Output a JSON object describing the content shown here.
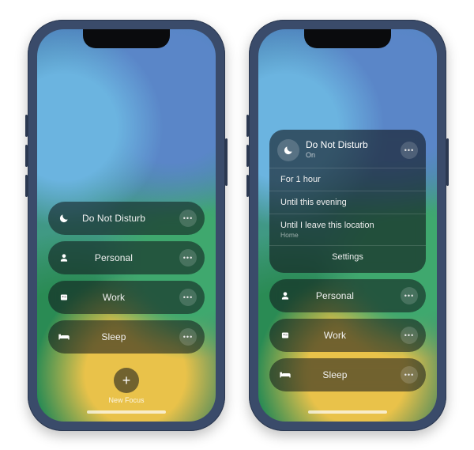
{
  "phone_left": {
    "focus_items": [
      {
        "icon": "moon",
        "label": "Do Not Disturb"
      },
      {
        "icon": "person",
        "label": "Personal"
      },
      {
        "icon": "work",
        "label": "Work"
      },
      {
        "icon": "bed",
        "label": "Sleep"
      }
    ],
    "new_focus_label": "New Focus"
  },
  "phone_right": {
    "expanded": {
      "icon": "moon",
      "title": "Do Not Disturb",
      "subtitle": "On",
      "options": [
        {
          "label": "For 1 hour"
        },
        {
          "label": "Until this evening"
        },
        {
          "label": "Until I leave this location",
          "sublabel": "Home"
        }
      ],
      "settings_label": "Settings"
    },
    "focus_items": [
      {
        "icon": "person",
        "label": "Personal"
      },
      {
        "icon": "work",
        "label": "Work"
      },
      {
        "icon": "bed",
        "label": "Sleep"
      }
    ]
  }
}
